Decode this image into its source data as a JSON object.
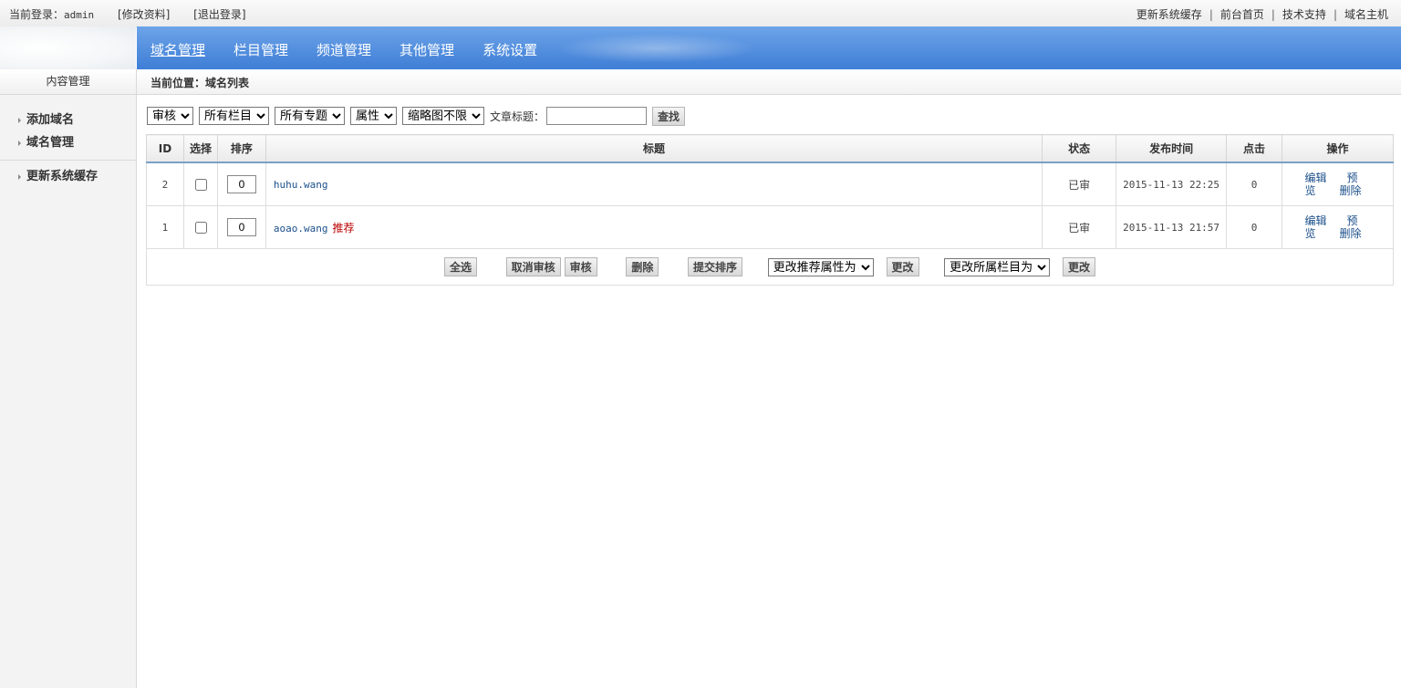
{
  "topbar": {
    "login_label": "当前登录：",
    "username": "admin",
    "edit_profile": "[修改资料]",
    "logout": "[退出登录]",
    "links": [
      "更新系统缓存",
      "前台首页",
      "技术支持",
      "域名主机"
    ]
  },
  "nav": {
    "items": [
      "域名管理",
      "栏目管理",
      "频道管理",
      "其他管理",
      "系统设置"
    ],
    "active": 0
  },
  "sidebar": {
    "header": "内容管理",
    "items": [
      "添加域名",
      "域名管理"
    ],
    "items2": [
      "更新系统缓存"
    ]
  },
  "breadcrumb": "当前位置：域名列表",
  "filters": {
    "status_selected": "审核",
    "column_selected": "所有栏目",
    "topic_selected": "所有专题",
    "attr_selected": "属性",
    "thumb_selected": "缩略图不限",
    "title_label": "文章标题：",
    "title_value": "",
    "search_button": "查找"
  },
  "table": {
    "headers": [
      "ID",
      "选择",
      "排序",
      "标题",
      "状态",
      "发布时间",
      "点击",
      "操作"
    ],
    "rows": [
      {
        "id": "2",
        "order": "0",
        "title": "huhu.wang",
        "tag": "",
        "status": "已审",
        "date": "2015-11-13 22:25",
        "clicks": "0",
        "op_edit": "编辑",
        "op_preview_1": "预",
        "op_preview_2": "览",
        "op_delete": "删除"
      },
      {
        "id": "1",
        "order": "0",
        "title": "aoao.wang",
        "tag": "推荐",
        "status": "已审",
        "date": "2015-11-13 21:57",
        "clicks": "0",
        "op_edit": "编辑",
        "op_preview_1": "预",
        "op_preview_2": "览",
        "op_delete": "删除"
      }
    ]
  },
  "footer": {
    "select_all": "全选",
    "cancel_review": "取消审核",
    "review": "审核",
    "delete": "删除",
    "submit_order": "提交排序",
    "recommend_selected": "更改推荐属性为",
    "change1": "更改",
    "column_change_selected": "更改所属栏目为",
    "change2": "更改"
  }
}
